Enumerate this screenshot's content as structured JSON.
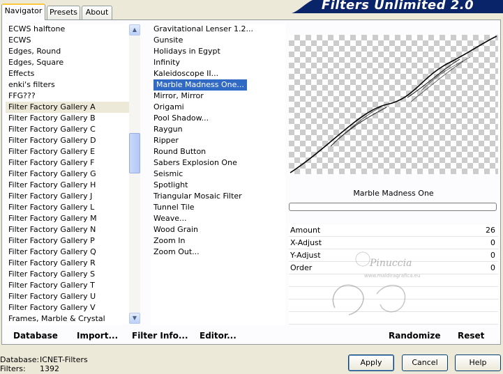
{
  "tabs": [
    {
      "label": "Navigator",
      "active": true
    },
    {
      "label": "Presets",
      "active": false
    },
    {
      "label": "About",
      "active": false
    }
  ],
  "app_title": "Filters Unlimited 2.0",
  "categories": {
    "items": [
      "ECWS halftone",
      "ECWS",
      "Edges, Round",
      "Edges, Square",
      "Effects",
      "enki's filters",
      "FFG???",
      "Filter Factory Gallery A",
      "Filter Factory Gallery B",
      "Filter Factory Gallery C",
      "Filter Factory Gallery D",
      "Filter Factory Gallery E",
      "Filter Factory Gallery F",
      "Filter Factory Gallery G",
      "Filter Factory Gallery H",
      "Filter Factory Gallery J",
      "Filter Factory Gallery L",
      "Filter Factory Gallery M",
      "Filter Factory Gallery N",
      "Filter Factory Gallery P",
      "Filter Factory Gallery Q",
      "Filter Factory Gallery R",
      "Filter Factory Gallery S",
      "Filter Factory Gallery T",
      "Filter Factory Gallery U",
      "Filter Factory Gallery V",
      "Frames, Marble & Crystal"
    ],
    "selected": "Filter Factory Gallery A"
  },
  "filters": {
    "items": [
      "Gravitational Lenser 1.2...",
      "Gunsite",
      "Holidays in Egypt",
      "Infinity",
      "Kaleidoscope II...",
      "Marble Madness One...",
      "Mirror, Mirror",
      "Origami",
      "Pool Shadow...",
      "Raygun",
      "Ripper",
      "Round Button",
      "Sabers Explosion One",
      "Seismic",
      "Spotlight",
      "Triangular Mosaic Filter",
      "Tunnel Tile",
      "Weave...",
      "Wood Grain",
      "Zoom In",
      "Zoom Out..."
    ],
    "selected": "Marble Madness One..."
  },
  "preview": {
    "filter_name": "Marble Madness One"
  },
  "params": [
    {
      "label": "Amount",
      "value": "26"
    },
    {
      "label": "X-Adjust",
      "value": "0"
    },
    {
      "label": "Y-Adjust",
      "value": "0"
    },
    {
      "label": "Order",
      "value": "0"
    }
  ],
  "toolbar": {
    "database": "Database",
    "import": "Import...",
    "filter_info": "Filter Info...",
    "editor": "Editor...",
    "randomize": "Randomize",
    "reset": "Reset"
  },
  "status": {
    "database_label": "Database:",
    "database_value": "ICNET-Filters",
    "filters_label": "Filters:",
    "filters_value": "1392"
  },
  "buttons": {
    "apply": "Apply",
    "cancel": "Cancel",
    "help": "Help"
  },
  "watermark": {
    "name": "Pinuccia",
    "site": "www.maldiragrafica.eu"
  },
  "colors": {
    "selection": "#316ac5",
    "banner": "#0a246a",
    "dialog_bg": "#ece9d8"
  }
}
